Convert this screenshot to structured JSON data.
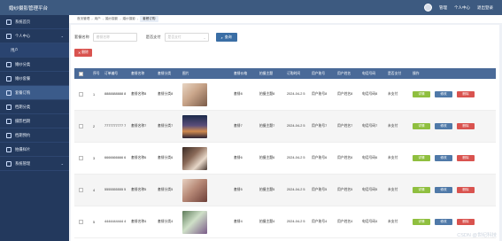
{
  "app": {
    "title": "婚纱摄影管理平台",
    "user": "管理",
    "profile": "个人中心",
    "logout": "退出登录"
  },
  "breadcrumb": {
    "items": [
      "首页管理",
      "用户",
      "婚纱摄影",
      "婚纱摄影",
      "套餐订购"
    ],
    "current": "套餐订购"
  },
  "sidebar": {
    "items": [
      {
        "label": "系统首页",
        "icon": "home-icon",
        "active": false
      },
      {
        "label": "个人中心",
        "icon": "user-icon",
        "active": false,
        "chev": "⌄"
      },
      {
        "label": "用户",
        "icon": "users-icon",
        "active": false
      },
      {
        "label": "婚纱分类",
        "icon": "folder-icon",
        "active": false
      },
      {
        "label": "婚纱套餐",
        "icon": "package-icon",
        "active": false
      },
      {
        "label": "套餐订购",
        "icon": "cart-icon",
        "active": true
      },
      {
        "label": "档期分类",
        "icon": "calendar-icon",
        "active": false
      },
      {
        "label": "摄影档期",
        "icon": "camera-icon",
        "active": false
      },
      {
        "label": "档期预约",
        "icon": "clock-icon",
        "active": false
      },
      {
        "label": "拍摄样片",
        "icon": "image-icon",
        "active": false
      },
      {
        "label": "系统管理",
        "icon": "gear-icon",
        "active": false,
        "chev": "⌄"
      }
    ]
  },
  "filters": {
    "name_label": "套餐名称",
    "name_placeholder": "套餐名称",
    "paid_label": "是否支付",
    "paid_placeholder": "是否支付",
    "search_label": "查询"
  },
  "toolbar": {
    "delete_label": "删除"
  },
  "table": {
    "headers": [
      "序号",
      "订单编号",
      "套餐名称",
      "套餐分类",
      "图片",
      "套餐价格",
      "拍摄主题",
      "订购时间",
      "用户账号",
      "用户姓名",
      "电话号码",
      "是否支付",
      "操作"
    ],
    "rows": [
      {
        "idx": "1",
        "order": "8888888888 8",
        "name": "套餐名称8",
        "cat": "套餐分类8",
        "price": "套餐8",
        "theme": "拍摄主题8",
        "time": "2024-04-2 5",
        "acc": "用户账号8",
        "uname": "用户姓名8",
        "phone": "电话号码8",
        "paid": "未支付",
        "img": "portrait"
      },
      {
        "idx": "2",
        "order": "7777777777 7",
        "name": "套餐名称7",
        "cat": "套餐分类7",
        "price": "套餐7",
        "theme": "拍摄主题7",
        "time": "2024-04-2 5",
        "acc": "用户账号7",
        "uname": "用户姓名7",
        "phone": "电话号码7",
        "paid": "未支付",
        "img": "sunset"
      },
      {
        "idx": "3",
        "order": "6666666666 6",
        "name": "套餐名称6",
        "cat": "套餐分类6",
        "price": "套餐6",
        "theme": "拍摄主题6",
        "time": "2024-04-2 5",
        "acc": "用户账号6",
        "uname": "用户姓名6",
        "phone": "电话号码6",
        "paid": "未支付",
        "img": "group"
      },
      {
        "idx": "4",
        "order": "5555555555 5",
        "name": "套餐名称5",
        "cat": "套餐分类5",
        "price": "套餐5",
        "theme": "拍摄主题5",
        "time": "2024-04-2 5",
        "acc": "用户账号5",
        "uname": "用户姓名5",
        "phone": "电话号码5",
        "paid": "未支付",
        "img": "flowers"
      },
      {
        "idx": "5",
        "order": "4444444444 4",
        "name": "套餐名称4",
        "cat": "套餐分类4",
        "price": "套餐4",
        "theme": "拍摄主题4",
        "time": "2024-04-2 5",
        "acc": "用户账号4",
        "uname": "用户姓名4",
        "phone": "电话号码4",
        "paid": "未支付",
        "img": "bouquet"
      }
    ],
    "actions": {
      "detail": "详情",
      "edit": "修改",
      "delete": "删除"
    }
  },
  "watermark": "CSDN @世纪科技",
  "colors": {
    "header": "#3d5a80",
    "sidebar": "#23395d",
    "detail": "#8fbf3f",
    "edit": "#4f79a8",
    "delete": "#d9534f"
  }
}
